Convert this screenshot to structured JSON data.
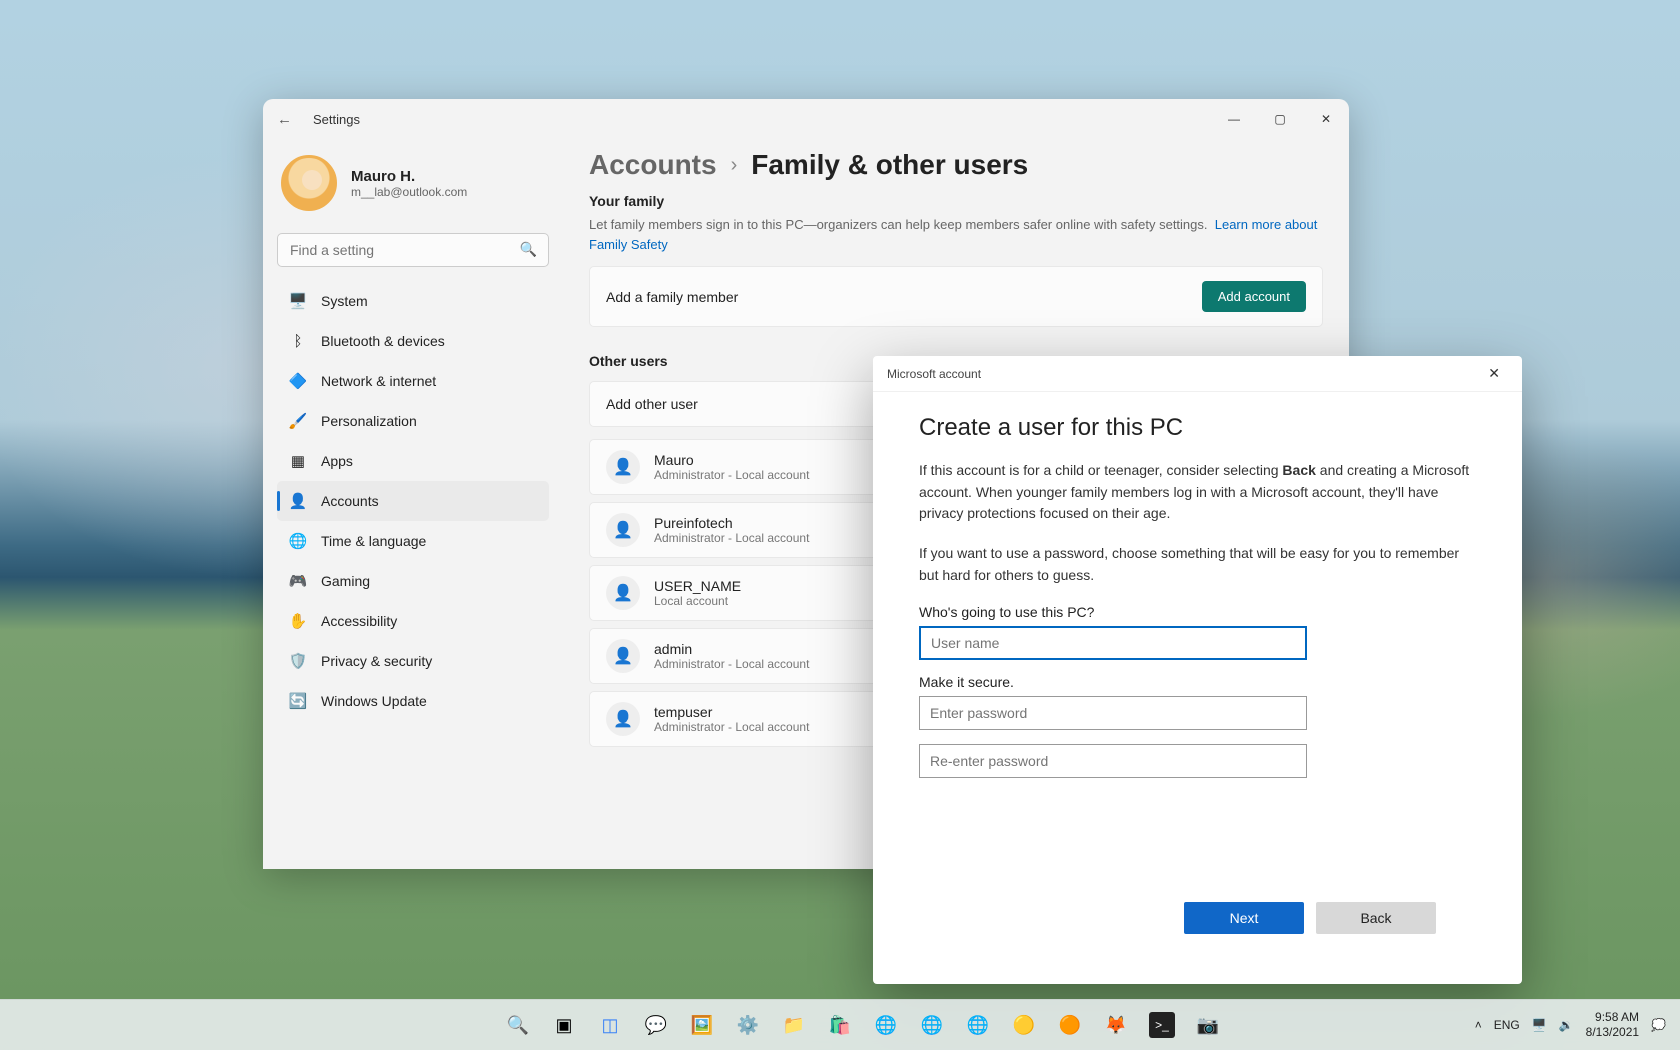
{
  "window": {
    "title": "Settings",
    "back": "←"
  },
  "user": {
    "name": "Mauro H.",
    "email": "m__lab@outlook.com"
  },
  "search": {
    "placeholder": "Find a setting"
  },
  "nav": {
    "items": [
      {
        "icon": "🖥️",
        "label": "System"
      },
      {
        "icon": "ᛒ",
        "label": "Bluetooth & devices"
      },
      {
        "icon": "🔷",
        "label": "Network & internet"
      },
      {
        "icon": "🖌️",
        "label": "Personalization"
      },
      {
        "icon": "▦",
        "label": "Apps"
      },
      {
        "icon": "👤",
        "label": "Accounts"
      },
      {
        "icon": "🌐",
        "label": "Time & language"
      },
      {
        "icon": "🎮",
        "label": "Gaming"
      },
      {
        "icon": "✋",
        "label": "Accessibility"
      },
      {
        "icon": "🛡️",
        "label": "Privacy & security"
      },
      {
        "icon": "🔄",
        "label": "Windows Update"
      }
    ],
    "selected_index": 5
  },
  "breadcrumb": {
    "root": "Accounts",
    "page": "Family & other users"
  },
  "family": {
    "heading": "Your family",
    "description": "Let family members sign in to this PC—organizers can help keep members safer online with safety settings.",
    "link": "Learn more about Family Safety",
    "card_text": "Add a family member",
    "card_button": "Add account"
  },
  "others": {
    "heading": "Other users",
    "add_text": "Add other user",
    "list": [
      {
        "name": "Mauro",
        "role": "Administrator - Local account"
      },
      {
        "name": "Pureinfotech",
        "role": "Administrator - Local account"
      },
      {
        "name": "USER_NAME",
        "role": "Local account"
      },
      {
        "name": "admin",
        "role": "Administrator - Local account"
      },
      {
        "name": "tempuser",
        "role": "Administrator - Local account"
      }
    ]
  },
  "modal": {
    "window_title": "Microsoft account",
    "heading": "Create a user for this PC",
    "p1a": "If this account is for a child or teenager, consider selecting ",
    "p1bold": "Back",
    "p1b": " and creating a Microsoft account. When younger family members log in with a Microsoft account, they'll have privacy protections focused on their age.",
    "p2": "If you want to use a password, choose something that will be easy for you to remember but hard for others to guess.",
    "who_label": "Who's going to use this PC?",
    "who_placeholder": "User name",
    "secure_label": "Make it secure.",
    "pw1_placeholder": "Enter password",
    "pw2_placeholder": "Re-enter password",
    "next": "Next",
    "back": "Back"
  },
  "taskbar": {
    "tray": {
      "lang": "ENG",
      "time": "9:58 AM",
      "date": "8/13/2021"
    }
  }
}
